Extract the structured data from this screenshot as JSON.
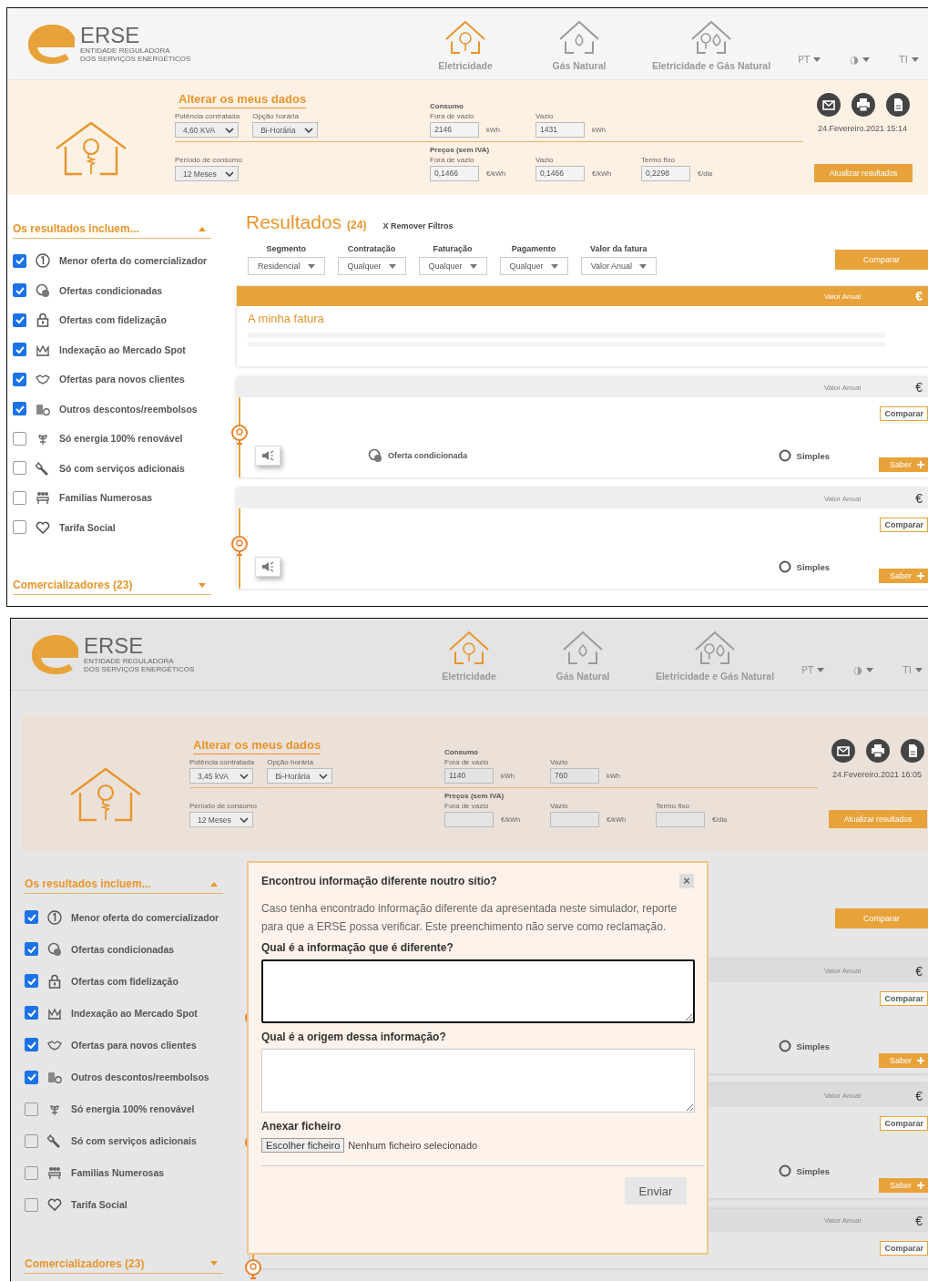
{
  "panels": [
    {
      "dimmed": false,
      "header": {
        "brand": "ERSE",
        "brand_lines": [
          "ENTIDADE REGULADORA",
          "DOS SERVIÇOS ENERGÉTICOS"
        ],
        "nav": [
          {
            "label": "Eletricidade",
            "selected": true
          },
          {
            "label": "Gás Natural",
            "selected": false
          },
          {
            "label": "Eletricidade e Gás Natural",
            "selected": false
          }
        ],
        "menus": [
          "PT",
          "◑",
          "TI"
        ]
      },
      "form": {
        "title": "Alterar os meus dados",
        "selects": [
          {
            "label": "Potência contratada",
            "value": "4,60 KVA"
          },
          {
            "label": "Opção horária",
            "value": "Bi-Horária"
          },
          {
            "label": "Período de consumo",
            "value": "12 Meses"
          }
        ],
        "consumo": {
          "heading": "Consumo",
          "fields": [
            {
              "label": "Fora de vazio",
              "value": "2146",
              "unit": "kWh"
            },
            {
              "label": "Vazio",
              "value": "1431",
              "unit": "kWh"
            }
          ]
        },
        "precos": {
          "heading": "Preços (sem IVA)",
          "fields": [
            {
              "label": "Fora de vazio",
              "value": "0,1466",
              "unit": "€/kWh"
            },
            {
              "label": "Vazio",
              "value": "0,1466",
              "unit": "€/kWh"
            },
            {
              "label": "Termo fixo",
              "value": "0,2298",
              "unit": "€/dia"
            }
          ]
        },
        "date": "24.Fevereiro.2021 15:14",
        "update_button": "Atualizar resultados"
      },
      "sidebar": {
        "title": "Os resultados incluem...",
        "items": [
          {
            "label": "Menor oferta do comercializador",
            "checked": true
          },
          {
            "label": "Ofertas condicionadas",
            "checked": true
          },
          {
            "label": "Ofertas com fidelização",
            "checked": true
          },
          {
            "label": "Indexação ao Mercado Spot",
            "checked": true
          },
          {
            "label": "Ofertas para novos clientes",
            "checked": true
          },
          {
            "label": "Outros descontos/reembolsos",
            "checked": true
          },
          {
            "label": "Só energia 100% renovável",
            "checked": false
          },
          {
            "label": "Só com serviços adicionais",
            "checked": false
          },
          {
            "label": "Familias Numerosas",
            "checked": false
          },
          {
            "label": "Tarifa Social",
            "checked": false
          }
        ],
        "section": "Comercializadores (23)"
      },
      "results": {
        "title": "Resultados",
        "count": "(24)",
        "clear": "X Remover Filtros",
        "filters": [
          {
            "label": "Segmento",
            "value": "Residencial"
          },
          {
            "label": "Contratação",
            "value": "Qualquer"
          },
          {
            "label": "Faturação",
            "value": "Qualquer"
          },
          {
            "label": "Pagamento",
            "value": "Qualquer"
          },
          {
            "label": "Valor da fatura",
            "value": "Valor Anual"
          }
        ],
        "compare": "Comparar",
        "cards": [
          {
            "kind": "bill",
            "amount_label": "Valor Anual",
            "currency": "€",
            "title": "A minha fatura"
          },
          {
            "kind": "offer",
            "amount_label": "Valor Anual",
            "currency": "€",
            "compare": "Comparar",
            "tag": "Oferta condicionada",
            "type": "Simples",
            "more": "Saber"
          },
          {
            "kind": "offer",
            "amount_label": "Valor Anual",
            "currency": "€",
            "compare": "Comparar",
            "type": "Simples",
            "more": "Saber"
          }
        ]
      }
    },
    {
      "dimmed": true,
      "header": {
        "brand": "ERSE",
        "brand_lines": [
          "ENTIDADE REGULADORA",
          "DOS SERVIÇOS ENERGÉTICOS"
        ],
        "nav": [
          {
            "label": "Eletricidade",
            "selected": true
          },
          {
            "label": "Gás Natural",
            "selected": false
          },
          {
            "label": "Eletricidade e Gás Natural",
            "selected": false
          }
        ],
        "menus": [
          "PT",
          "◑",
          "TI"
        ]
      },
      "form": {
        "title": "Alterar os meus dados",
        "selects": [
          {
            "label": "Potência contratada",
            "value": "3,45 kVA"
          },
          {
            "label": "Opção horária",
            "value": "Bi-Horária"
          },
          {
            "label": "Período de consumo",
            "value": "12 Meses"
          }
        ],
        "consumo": {
          "heading": "Consumo",
          "fields": [
            {
              "label": "Fora de vazio",
              "value": "1140",
              "unit": "kWh"
            },
            {
              "label": "Vazio",
              "value": "760",
              "unit": "kWh"
            }
          ]
        },
        "precos": {
          "heading": "Preços (sem IVA)",
          "fields": [
            {
              "label": "Fora de vazio",
              "unit": "€/kWh"
            },
            {
              "label": "Vazio",
              "unit": "€/kWh"
            },
            {
              "label": "Termo fixo",
              "unit": "€/dia"
            }
          ]
        },
        "date": "24.Fevereiro.2021 16:05",
        "update_button": "Atualizar resultados"
      },
      "sidebar": {
        "title": "Os resultados incluem...",
        "items": [
          {
            "label": "Menor oferta do comercializador",
            "checked": true
          },
          {
            "label": "Ofertas condicionadas",
            "checked": true
          },
          {
            "label": "Ofertas com fidelização",
            "checked": true
          },
          {
            "label": "Indexação ao Mercado Spot",
            "checked": true
          },
          {
            "label": "Ofertas para novos clientes",
            "checked": true
          },
          {
            "label": "Outros descontos/reembolsos",
            "checked": true
          },
          {
            "label": "Só energia 100% renovável",
            "checked": false
          },
          {
            "label": "Só com serviços adicionais",
            "checked": false
          },
          {
            "label": "Familias Numerosas",
            "checked": false
          },
          {
            "label": "Tarifa Social",
            "checked": false
          }
        ],
        "section": "Comercializadores (23)"
      },
      "results": {
        "compare": "Comparar",
        "cards": [
          {
            "kind": "offer",
            "amount_label": "Valor Anual",
            "currency": "€",
            "compare": "Comparar",
            "type": "Simples",
            "more": "Saber"
          },
          {
            "kind": "offer",
            "amount_label": "Valor Anual",
            "currency": "€",
            "compare": "Comparar",
            "type": "Simples",
            "more": "Saber"
          },
          {
            "kind": "stub",
            "amount_label": "Valor Anual",
            "currency": "€",
            "compare": "Comparar"
          }
        ]
      },
      "modal": {
        "title": "Encontrou informação diferente noutro sítio?",
        "close": "×",
        "text": "Caso tenha encontrado informação diferente da apresentada neste simulador, reporte para que a ERSE possa verificar. Este preenchimento não serve como reclamação.",
        "questions": [
          {
            "label": "Qual é a informação que é diferente?",
            "focused": true
          },
          {
            "label": "Qual é a origem dessa informação?",
            "focused": false
          }
        ],
        "attach_label": "Anexar ficheiro",
        "file_button": "Escolher ficheiro",
        "file_status": "Nenhum ficheiro selecionado",
        "submit": "Enviar"
      }
    }
  ]
}
